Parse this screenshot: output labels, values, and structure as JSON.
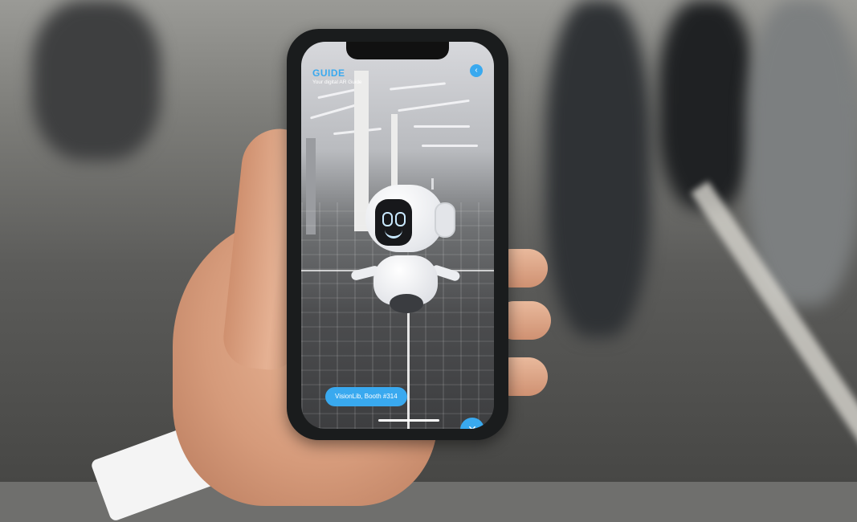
{
  "app": {
    "brand": "GUIDE",
    "tagline": "Your digital AR Guide"
  },
  "ar_view": {
    "booth_label": "VisionLib, Booth #314"
  },
  "icons": {
    "back": "chevron-left-icon",
    "close": "close-icon",
    "robot": "robot-guide-icon"
  },
  "colors": {
    "accent": "#39a9ef",
    "phone_frame": "#1a1c1d",
    "robot_face": "#17181b"
  }
}
